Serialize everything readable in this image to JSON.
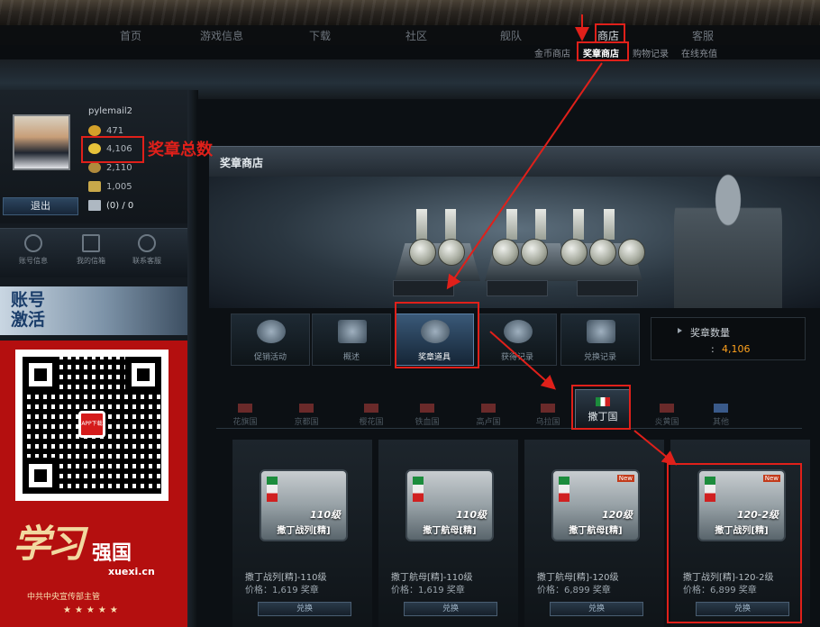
{
  "nav": {
    "items": [
      "首页",
      "游戏信息",
      "下载",
      "社区",
      "舰队",
      "商店",
      "客服"
    ],
    "active": "商店"
  },
  "subnav": {
    "items": [
      "金币商店",
      "奖章商店",
      "购物记录",
      "在线充值"
    ],
    "active": "奖章商店"
  },
  "profile": {
    "username": "pylemail2",
    "stats": [
      {
        "icon": "gold-coin-icon",
        "value": "471"
      },
      {
        "icon": "medal-icon",
        "value": "4,106"
      },
      {
        "icon": "chip-icon",
        "value": "2,110"
      },
      {
        "icon": "trophy-icon",
        "value": "1,005"
      },
      {
        "icon": "mail-icon",
        "value": "(0) / 0"
      }
    ],
    "logout_label": "退出"
  },
  "quick_links": [
    "账号信息",
    "我的信箱",
    "联系客服"
  ],
  "activate_banner": {
    "line1": "账号",
    "line2": "激活"
  },
  "xuexi": {
    "calligraphy": "学习",
    "main": "强国",
    "domain": "xuexi.cn",
    "sub": "中共中央宣传部主管",
    "stars": "★★★★★",
    "app_badge": "APP下载"
  },
  "panel": {
    "title": "奖章商店"
  },
  "tabs": [
    {
      "label": "促销活动",
      "icon": "wf-badge-icon"
    },
    {
      "label": "概述",
      "icon": "scroll-icon"
    },
    {
      "label": "奖章道具",
      "icon": "eagle-emblem-icon",
      "active": true
    },
    {
      "label": "获得记录",
      "icon": "medals-icon"
    },
    {
      "label": "兑换记录",
      "icon": "cart-icon"
    }
  ],
  "medal_count": {
    "label": "奖章数量",
    "colon": ":",
    "value": "4,106"
  },
  "nations": [
    {
      "label": "花旗国"
    },
    {
      "label": "京都国"
    },
    {
      "label": "樱花国"
    },
    {
      "label": "铁血国"
    },
    {
      "label": "高卢国"
    },
    {
      "label": "乌拉国"
    },
    {
      "label": "撒丁国",
      "active": true
    },
    {
      "label": "炎黄国"
    },
    {
      "label": "其他"
    }
  ],
  "cards": [
    {
      "ship_level": "110级",
      "ship_name": "撒丁战列[精]",
      "title": "撒丁战列[精]-110级",
      "price": "价格：1,619 奖章",
      "button": "兑换",
      "new": ""
    },
    {
      "ship_level": "110级",
      "ship_name": "撒丁航母[精]",
      "title": "撒丁航母[精]-110级",
      "price": "价格：1,619 奖章",
      "button": "兑换",
      "new": ""
    },
    {
      "ship_level": "120级",
      "ship_name": "撒丁航母[精]",
      "title": "撒丁航母[精]-120级",
      "price": "价格：6,899 奖章",
      "button": "兑换",
      "new": "New"
    },
    {
      "ship_level": "120-2级",
      "ship_name": "撒丁战列[精]",
      "title": "撒丁战列[精]-120-2级",
      "price": "价格：6,899 奖章",
      "button": "兑换",
      "new": "New"
    }
  ],
  "annotation": {
    "label": "奖章总数",
    "color": "#e0201a"
  }
}
